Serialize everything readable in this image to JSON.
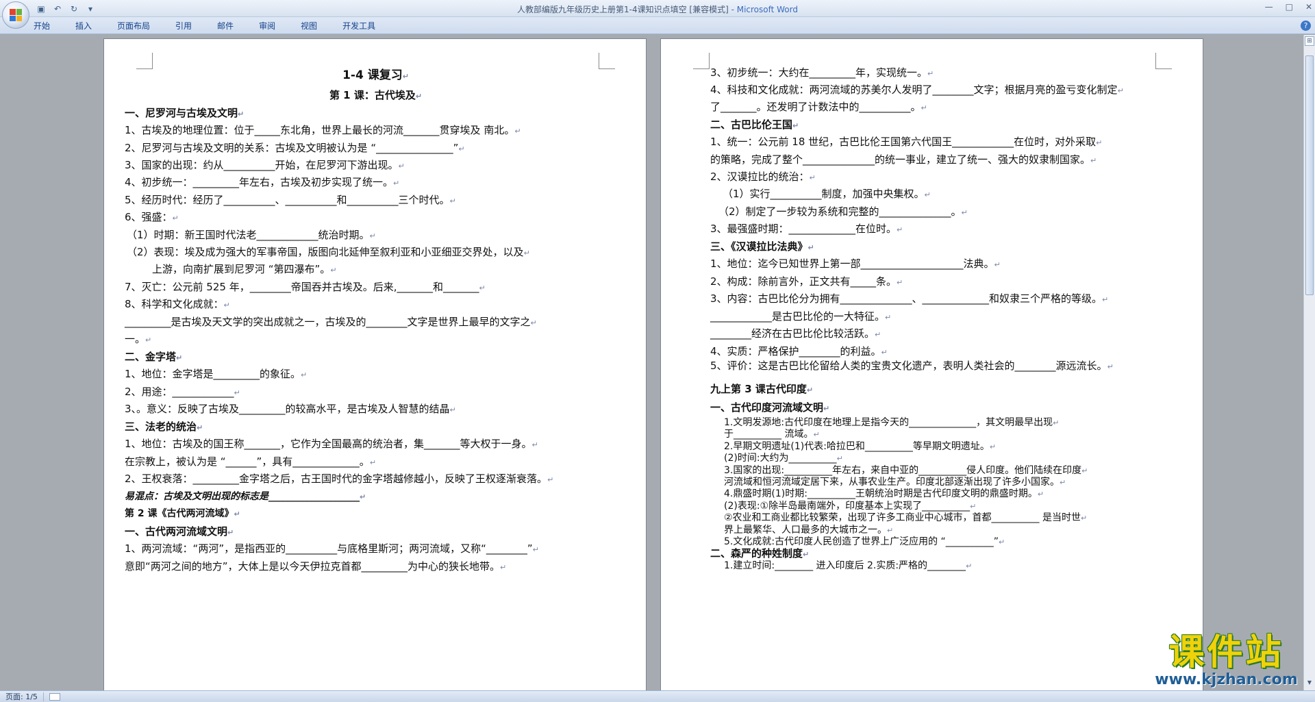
{
  "window": {
    "title": "人教部编版九年级历史上册第1-4课知识点填空 [兼容模式]",
    "app_name": " - Microsoft Word",
    "min_icon": "minimize-icon",
    "max_icon": "maximize-icon",
    "close_icon": "close-icon",
    "min": "—",
    "max": "□",
    "close": "✕"
  },
  "qat": {
    "save": "▣",
    "undo": "↶",
    "redo": "↻",
    "customize": "▾"
  },
  "ribbon": {
    "tabs": [
      "开始",
      "插入",
      "页面布局",
      "引用",
      "邮件",
      "审阅",
      "视图",
      "开发工具"
    ],
    "help": "?"
  },
  "page1": {
    "lines": [
      "1-4 课复习",
      "第 1 课：古代埃及",
      "一、尼罗河与古埃及文明",
      "1、古埃及的地理位置：位于_____东北角，世界上最长的河流_______贯穿埃及   南北。",
      "2、尼罗河与古埃及文明的关系：古埃及文明被认为是 “_______________”",
      "3、国家的出现：约从__________开始，在尼罗河下游出现。",
      "4、初步统一：_________年左右，古埃及初步实现了统一。",
      "5、经历时代：经历了__________、__________和__________三个时代。",
      "6、强盛：",
      "（1）时期：新王国时代法老____________统治时期。",
      "（2）表现：埃及成为强大的军事帝国，版图向北延伸至叙利亚和小亚细亚交界处，以及",
      "上游，向南扩展到尼罗河 “第四瀑布”。",
      "7、灭亡：公元前 525 年，________帝国吞并古埃及。后来,_______和_______",
      "8、科学和文化成就：",
      "_________是古埃及天文学的突出成就之一，古埃及的________文字是世界上最早的文字之",
      "一。",
      "二、金字塔",
      "1、地位：金字塔是_________的象征。",
      "2、用途：____________",
      "3、。意义：反映了古埃及_________的较高水平，是古埃及人智慧的结晶",
      "三、法老的统治",
      "1、地位：古埃及的国王称_______，它作为全国最高的统治者，集_______等大权于一身。",
      "在宗教上，被认为是 “______”，具有_____________。",
      "2、王权衰落：_________金字塔之后，古王国时代的金字塔越修越小，反映了王权逐渐衰落。",
      "易混点：古埃及文明出现的标志是___________________",
      "第 2 课《古代两河流域》",
      "一、古代两河流域文明",
      "1、两河流域：“两河”，是指西亚的__________与底格里斯河；两河流域，又称“________”",
      "意即“两河之间的地方”，大体上是以今天伊拉克首都_________为中心的狭长地带。"
    ]
  },
  "page2": {
    "lines": [
      "3、初步统一：大约在_________年，实现统一。",
      "4、科技和文化成就：两河流域的苏美尔人发明了________文字；根据月亮的盈亏变化制定",
      "了_______。还发明了计数法中的__________。",
      "二、古巴比伦王国",
      "1、统一：公元前 18 世纪，古巴比伦王国第六代国王____________在位时，对外采取",
      "的策略，完成了整个______________的统一事业，建立了统一、强大的奴隶制国家。",
      "2、汉谟拉比的统治：",
      "（1）实行__________制度，加强中央集权。",
      "（2）制定了一步较为系统和完整的______________。",
      "3、最强盛时期：_____________在位时。",
      "三、《汉谟拉比法典》",
      "1、地位：迄今已知世界上第一部____________________法典。",
      "2、构成：除前言外，正文共有_____条。",
      "3、内容：古巴比伦分为拥有______________、_____________和奴隶三个严格的等级。",
      "____________是古巴比伦的一大特征。",
      "________经济在古巴比伦比较活跃。",
      "4、实质：严格保护________的利益。",
      "5、评价：这是古巴比伦留给人类的宝贵文化遗产，表明人类社会的________源远流长。",
      "九上第 3 课古代印度",
      "一、古代印度河流域文明",
      "1.文明发源地:古代印度在地理上是指今天的______________，其文明最早出现",
      "于__________  流域。",
      "2.早期文明遗址(1)代表:哈拉巴和__________等早期文明遗址。",
      "(2)时间:大约为__________",
      "3.国家的出现:__________年左右，来自中亚的__________侵人印度。他们陆续在印度",
      "河流域和恒河流域定居下来，从事农业生产。印度北部逐渐出现了许多小国家。",
      "4.鼎盛时期(1)时期:__________王朝统治时期是古代印度文明的鼎盛时期。",
      "(2)表现:①除半岛最南端外，印度基本上实现了__________",
      "②农业和工商业都比较繁荣，出现了许多工商业中心城市，首都__________  是当时世",
      "界上最繁华、人口最多的大城市之一。",
      "5.文化成就:古代印度人民创造了世界上广泛应用的 “__________”",
      "二、森严的种姓制度",
      "1.建立时间:________  进入印度后  2.实质:严格的________"
    ]
  },
  "statusbar": {
    "page": "页面: 1/5",
    "ico": "proofing-icon"
  },
  "watermark": {
    "main": "课件站",
    "url": "www.kjzhan.com"
  },
  "paragraph_mark": "↵"
}
